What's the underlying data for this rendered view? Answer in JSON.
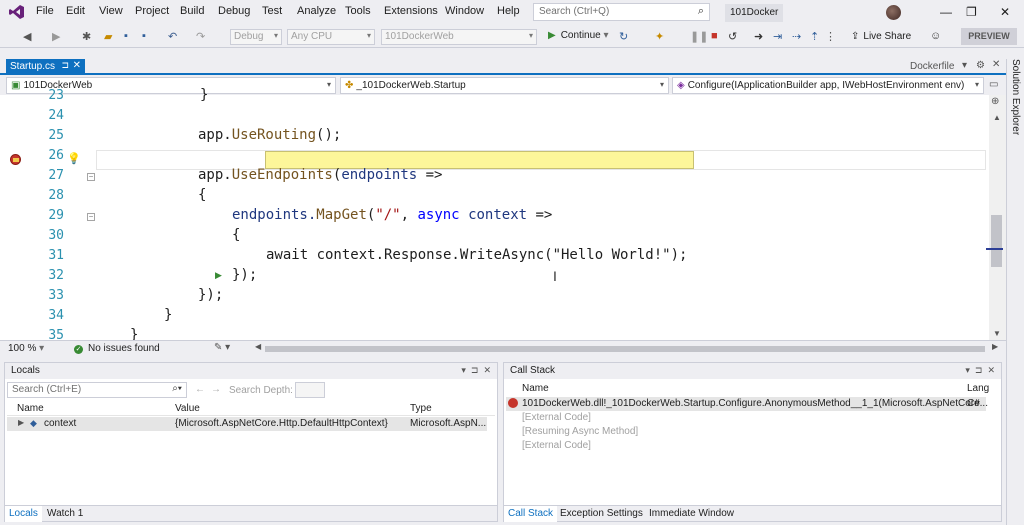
{
  "menu": [
    "File",
    "Edit",
    "View",
    "Project",
    "Build",
    "Debug",
    "Test",
    "Analyze",
    "Tools",
    "Extensions",
    "Window",
    "Help"
  ],
  "search": {
    "placeholder": "Search (Ctrl+Q)"
  },
  "solution_name": "101Docker",
  "window_controls": {
    "minimize": "—",
    "restore": "❐",
    "close": "✕"
  },
  "toolbar": {
    "config": "Debug",
    "platform": "Any CPU",
    "startup": "101DockerWeb",
    "continue_label": "Continue",
    "live_share": "Live Share",
    "preview": "PREVIEW"
  },
  "tabs": {
    "active": "Startup.cs",
    "other": "Dockerfile"
  },
  "sidebar_label": "Solution Explorer",
  "navbar": {
    "project": "101DockerWeb",
    "class": "_101DockerWeb.Startup",
    "member": "Configure(IApplicationBuilder app, IWebHostEnvironment env)"
  },
  "editor": {
    "line_numbers": [
      "23",
      "24",
      "25",
      "26",
      "27",
      "28",
      "29",
      "30",
      "31",
      "32",
      "33",
      "34",
      "35"
    ],
    "code": {
      "l25_obj": "app.",
      "l25_method": "UseRouting",
      "l25_rest": "();",
      "l27_obj": "app.",
      "l27_method": "UseEndpoints",
      "l27_paren": "(",
      "l27_param": "endpoints",
      "l27_arrow": " =>",
      "l28": "{",
      "l29_obj": "endpoints.",
      "l29_method": "MapGet",
      "l29_paren": "(",
      "l29_str": "\"/\"",
      "l29_comma": ", ",
      "l29_kw": "async",
      "l29_sp": " ",
      "l29_param": "context",
      "l29_arrow": " =>",
      "l30": "{",
      "l31": "await context.Response.WriteAsync(\"Hello World!\");",
      "l32": "});",
      "l33": "});",
      "l34": "}",
      "l35": "}",
      "l23": "}"
    },
    "zoom": "100 %",
    "issues": "No issues found"
  },
  "locals": {
    "title": "Locals",
    "search_placeholder": "Search (Ctrl+E)",
    "search_depth": "Search Depth:",
    "columns": [
      "Name",
      "Value",
      "Type"
    ],
    "rows": [
      {
        "name": "context",
        "value": "{Microsoft.AspNetCore.Http.DefaultHttpContext}",
        "type": "Microsoft.AspN..."
      }
    ],
    "tabs": [
      "Locals",
      "Watch 1"
    ]
  },
  "callstack": {
    "title": "Call Stack",
    "columns": [
      "Name",
      "Lang"
    ],
    "rows": [
      {
        "name": "101DockerWeb.dll!_101DockerWeb.Startup.Configure.AnonymousMethod__1_1(Microsoft.AspNetCore...",
        "lang": "C#"
      },
      {
        "name": "[External Code]",
        "lang": ""
      },
      {
        "name": "[Resuming Async Method]",
        "lang": ""
      },
      {
        "name": "[External Code]",
        "lang": ""
      }
    ],
    "tabs": [
      "Call Stack",
      "Exception Settings",
      "Immediate Window"
    ]
  }
}
